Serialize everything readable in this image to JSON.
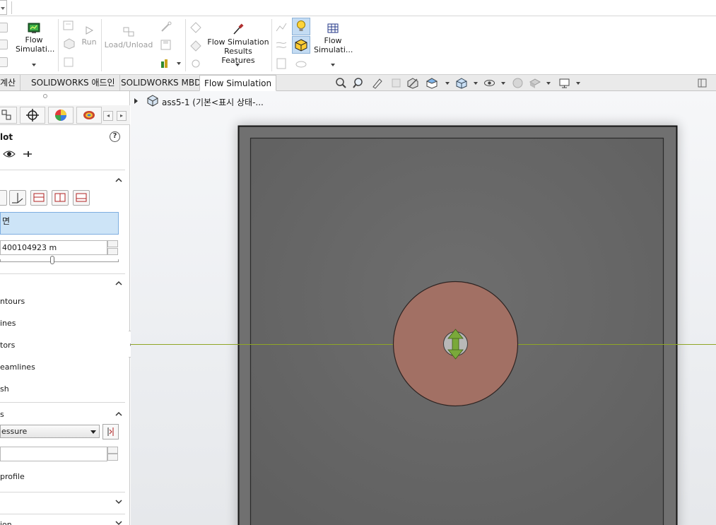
{
  "ribbon": {
    "flow_sim_label": "Flow Simulati...",
    "run_label": "Run",
    "load_unload_label": "Load/Unload",
    "results_features_label": "Flow Simulation Results Features",
    "flow_sim_label2": "Flow Simulati..."
  },
  "tabs": [
    {
      "label": "계산"
    },
    {
      "label": "SOLIDWORKS 애드인"
    },
    {
      "label": "SOLIDWORKS MBD"
    },
    {
      "label": "Flow Simulation"
    }
  ],
  "tree": {
    "node_label": "ass5-1  (기본<표시 상태-..."
  },
  "panel": {
    "title": "lot",
    "selection_text": "면",
    "offset_value": "400104923 m",
    "display_options": [
      "ntours",
      "ines",
      "tors",
      "eamlines",
      "sh"
    ],
    "section_label": "s",
    "parameter_value": "essure",
    "profile_label": "profile",
    "bottom_label": "ion"
  },
  "colors": {
    "accent_blue": "#cde4f7",
    "part_face": "#676767",
    "disc_face": "#a27064",
    "axis_line": "#8fa626",
    "arrow_green": "#7aa93a"
  }
}
